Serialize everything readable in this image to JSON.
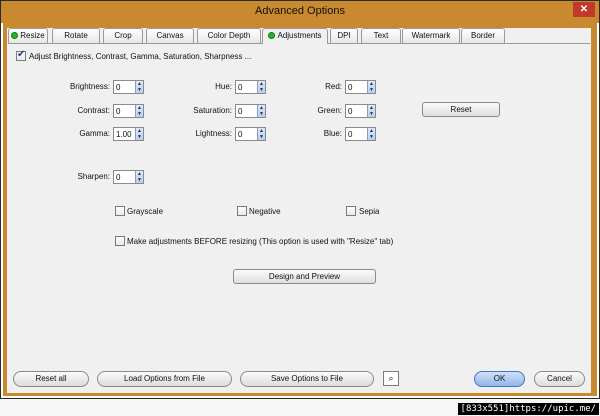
{
  "window": {
    "title": "Advanced Options",
    "close_glyph": "✕"
  },
  "tabs": [
    {
      "label": "Resize",
      "dot": true
    },
    {
      "label": "Rotate",
      "dot": false
    },
    {
      "label": "Crop",
      "dot": false
    },
    {
      "label": "Canvas",
      "dot": false
    },
    {
      "label": "Color Depth",
      "dot": false
    },
    {
      "label": "Adjustments",
      "dot": true,
      "active": true
    },
    {
      "label": "DPI",
      "dot": false
    },
    {
      "label": "Text",
      "dot": false
    },
    {
      "label": "Watermark",
      "dot": false
    },
    {
      "label": "Border",
      "dot": false
    }
  ],
  "adjust_checkbox": {
    "label": "Adjust Brightness, Contrast, Gamma, Saturation, Sharpness ...",
    "checked": true
  },
  "fields": {
    "brightness": {
      "label": "Brightness:",
      "value": "0"
    },
    "contrast": {
      "label": "Contrast:",
      "value": "0"
    },
    "gamma": {
      "label": "Gamma:",
      "value": "1.00"
    },
    "hue": {
      "label": "Hue:",
      "value": "0"
    },
    "saturation": {
      "label": "Saturation:",
      "value": "0"
    },
    "lightness": {
      "label": "Lightness:",
      "value": "0"
    },
    "red": {
      "label": "Red:",
      "value": "0"
    },
    "green": {
      "label": "Green:",
      "value": "0"
    },
    "blue": {
      "label": "Blue:",
      "value": "0"
    },
    "sharpen": {
      "label": "Sharpen:",
      "value": "0"
    }
  },
  "reset_label": "Reset",
  "options": {
    "grayscale": {
      "label": "Grayscale",
      "checked": false
    },
    "negative": {
      "label": "Negative",
      "checked": false
    },
    "sepia": {
      "label": "Sepia",
      "checked": false
    },
    "before_resize": {
      "label": "Make adjustments BEFORE resizing (This option is used with \"Resize\" tab)",
      "checked": false
    }
  },
  "design_preview_label": "Design and Preview",
  "footer": {
    "reset_all": "Reset all",
    "load_options": "Load Options from File",
    "save_options": "Save Options to File",
    "ok": "OK",
    "cancel": "Cancel"
  },
  "watermark": "[833x551]https://upic.me/"
}
